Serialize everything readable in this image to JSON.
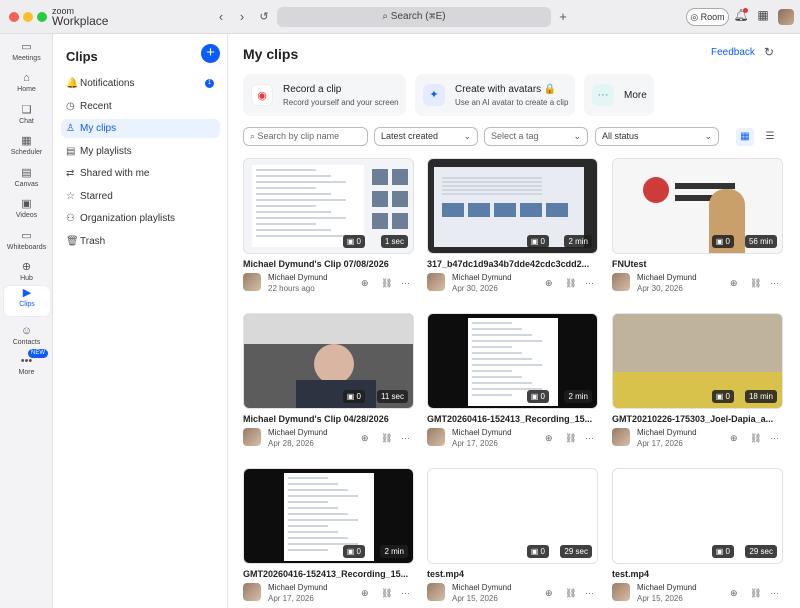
{
  "app": {
    "brand_small": "zoom",
    "brand_large": "Workplace"
  },
  "topbar": {
    "search_label": "Search (⌘E)",
    "room_label": "Room"
  },
  "rail": [
    {
      "icon": "video-icon",
      "glyph": "▭",
      "label": "Meetings"
    },
    {
      "icon": "home-icon",
      "glyph": "⌂",
      "label": "Home"
    },
    {
      "icon": "chat-icon",
      "glyph": "❏",
      "label": "Chat"
    },
    {
      "icon": "calendar-icon",
      "glyph": "▦",
      "label": "Scheduler"
    },
    {
      "icon": "canvas-icon",
      "glyph": "▤",
      "label": "Canvas"
    },
    {
      "icon": "videos-icon",
      "glyph": "▣",
      "label": "Videos"
    },
    {
      "icon": "whiteboard-icon",
      "glyph": "▭",
      "label": "Whiteboards"
    },
    {
      "icon": "hub-icon",
      "glyph": "⊕",
      "label": "Hub"
    },
    {
      "icon": "clips-icon",
      "glyph": "▶",
      "label": "Clips"
    },
    {
      "icon": "contacts-icon",
      "glyph": "☺",
      "label": "Contacts"
    },
    {
      "icon": "more-icon",
      "glyph": "•••",
      "label": "More"
    }
  ],
  "rail_new_badge": "NEW",
  "panel": {
    "title": "Clips",
    "items": [
      {
        "label": "Notifications",
        "glyph": "🔔",
        "icon": "bell-icon",
        "badge": "1"
      },
      {
        "label": "Recent",
        "glyph": "◷",
        "icon": "clock-icon"
      },
      {
        "label": "My clips",
        "glyph": "♙",
        "icon": "user-icon"
      },
      {
        "label": "My playlists",
        "glyph": "▤",
        "icon": "playlist-icon"
      },
      {
        "label": "Shared with me",
        "glyph": "⇄",
        "icon": "share-icon"
      },
      {
        "label": "Starred",
        "glyph": "☆",
        "icon": "star-icon"
      },
      {
        "label": "Organization playlists",
        "glyph": "⚇",
        "icon": "org-icon"
      },
      {
        "label": "Trash",
        "glyph": "🗑",
        "icon": "trash-icon"
      }
    ]
  },
  "main": {
    "title": "My clips",
    "feedback": "Feedback",
    "actions": [
      {
        "title": "Record a clip",
        "sub": "Record yourself and your screen",
        "glyph": "◉",
        "icon": "record-icon"
      },
      {
        "title": "Create with avatars 🔒",
        "sub": "Use an AI avatar to create a clip",
        "glyph": "✦",
        "icon": "avatar-sparkle-icon"
      },
      {
        "title": "More",
        "sub": "",
        "glyph": "···",
        "icon": "more-dots-icon"
      }
    ],
    "filters": {
      "search_placeholder": "Search by clip name",
      "sort": "Latest created",
      "tag": "Select a tag",
      "status": "All status"
    }
  },
  "clips": [
    {
      "title": "Michael Dymund's Clip 07/08/2026",
      "owner": "Michael Dymund",
      "date": "22 hours ago",
      "views": "0",
      "duration": "1 sec"
    },
    {
      "title": "317_b47dc1d9a34b7dde42cdc3cdd2...",
      "owner": "Michael Dymund",
      "date": "Apr 30, 2026",
      "views": "0",
      "duration": "2 min"
    },
    {
      "title": "FNUtest",
      "owner": "Michael Dymund",
      "date": "Apr 30, 2026",
      "views": "0",
      "duration": "56 min"
    },
    {
      "title": "Michael Dymund's Clip 04/28/2026",
      "owner": "Michael Dymund",
      "date": "Apr 28, 2026",
      "views": "0",
      "duration": "11 sec"
    },
    {
      "title": "GMT20260416-152413_Recording_15...",
      "owner": "Michael Dymund",
      "date": "Apr 17, 2026",
      "views": "0",
      "duration": "2 min"
    },
    {
      "title": "GMT20210226-175303_Joel-Dapia_a...",
      "owner": "Michael Dymund",
      "date": "Apr 17, 2026",
      "views": "0",
      "duration": "18 min"
    },
    {
      "title": "GMT20260416-152413_Recording_15...",
      "owner": "Michael Dymund",
      "date": "Apr 17, 2026",
      "views": "0",
      "duration": "2 min"
    },
    {
      "title": "test.mp4",
      "owner": "Michael Dymund",
      "date": "Apr 15, 2026",
      "views": "0",
      "duration": "29 sec"
    },
    {
      "title": "test.mp4",
      "owner": "Michael Dymund",
      "date": "Apr 15, 2026",
      "views": "0",
      "duration": "29 sec"
    }
  ]
}
